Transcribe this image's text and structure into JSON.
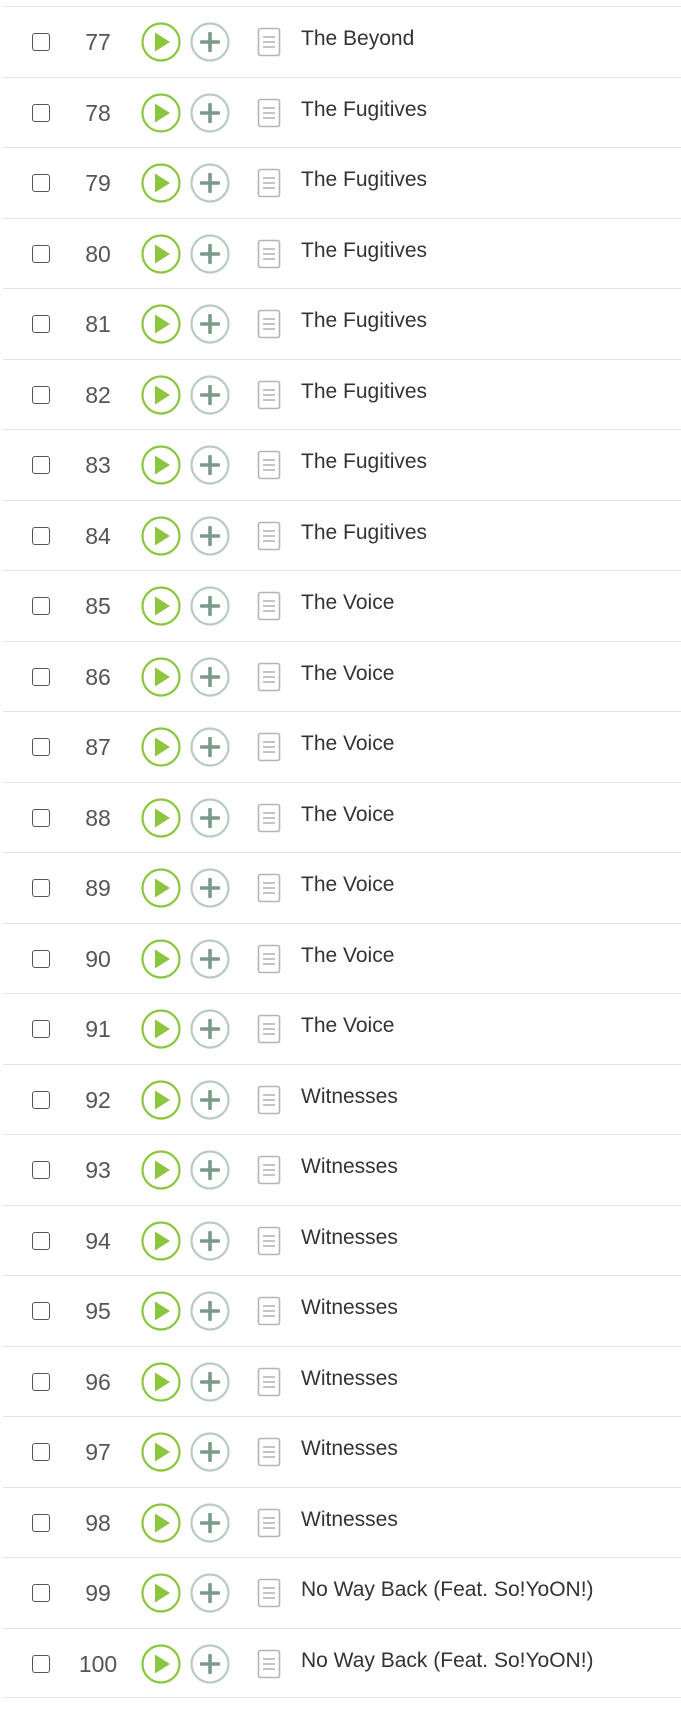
{
  "colors": {
    "play_accent": "#8cc63f",
    "add_accent": "#7a9a8a",
    "divider": "#e3e3e3",
    "rank_text": "#555555",
    "title_text": "#333333"
  },
  "icons": {
    "checkbox": "checkbox-icon",
    "play": "play-icon",
    "add": "add-icon",
    "lyrics": "lyrics-icon"
  },
  "tracks": [
    {
      "rank": "77",
      "title": "The Beyond"
    },
    {
      "rank": "78",
      "title": "The Fugitives"
    },
    {
      "rank": "79",
      "title": "The Fugitives"
    },
    {
      "rank": "80",
      "title": "The Fugitives"
    },
    {
      "rank": "81",
      "title": "The Fugitives"
    },
    {
      "rank": "82",
      "title": "The Fugitives"
    },
    {
      "rank": "83",
      "title": "The Fugitives"
    },
    {
      "rank": "84",
      "title": "The Fugitives"
    },
    {
      "rank": "85",
      "title": "The Voice"
    },
    {
      "rank": "86",
      "title": "The Voice"
    },
    {
      "rank": "87",
      "title": "The Voice"
    },
    {
      "rank": "88",
      "title": "The Voice"
    },
    {
      "rank": "89",
      "title": "The Voice"
    },
    {
      "rank": "90",
      "title": "The Voice"
    },
    {
      "rank": "91",
      "title": "The Voice"
    },
    {
      "rank": "92",
      "title": "Witnesses"
    },
    {
      "rank": "93",
      "title": "Witnesses"
    },
    {
      "rank": "94",
      "title": "Witnesses"
    },
    {
      "rank": "95",
      "title": "Witnesses"
    },
    {
      "rank": "96",
      "title": "Witnesses"
    },
    {
      "rank": "97",
      "title": "Witnesses"
    },
    {
      "rank": "98",
      "title": "Witnesses"
    },
    {
      "rank": "99",
      "title": "No Way Back (Feat. So!YoON!)"
    },
    {
      "rank": "100",
      "title": "No Way Back (Feat. So!YoON!)"
    }
  ]
}
